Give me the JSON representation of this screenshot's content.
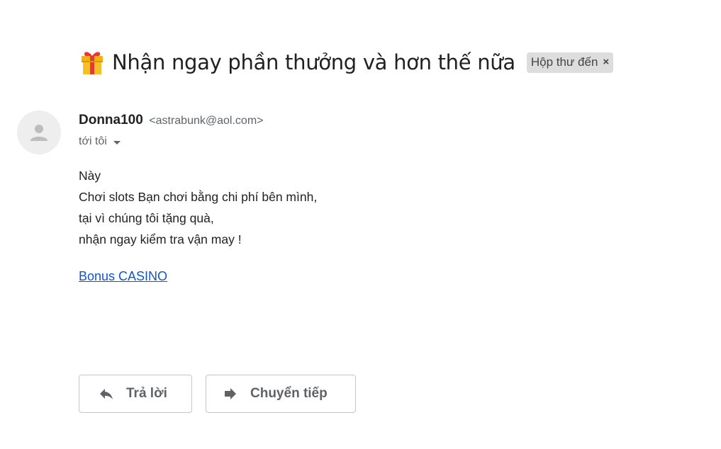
{
  "subject": {
    "text": "Nhận ngay phần thưởng và hơn thế nữa",
    "icon": "gift-icon",
    "label": "Hộp thư đến",
    "label_remove": "×"
  },
  "sender": {
    "name": "Donna100",
    "email": "<astrabunk@aol.com>",
    "recipient": "tới tôi"
  },
  "body": {
    "lines": [
      "Này",
      "Chơi slots Bạn chơi bằng chi phí bên mình,",
      "tại vì chúng tôi tặng quà,",
      "nhận ngay kiểm tra vận may !"
    ],
    "link_text": "Bonus CASINO"
  },
  "actions": {
    "reply_label": "Trả lời",
    "forward_label": "Chuyển tiếp"
  },
  "colors": {
    "link": "#1155cc",
    "label_chip_bg": "#dddddd",
    "button_text": "#5f6368"
  }
}
